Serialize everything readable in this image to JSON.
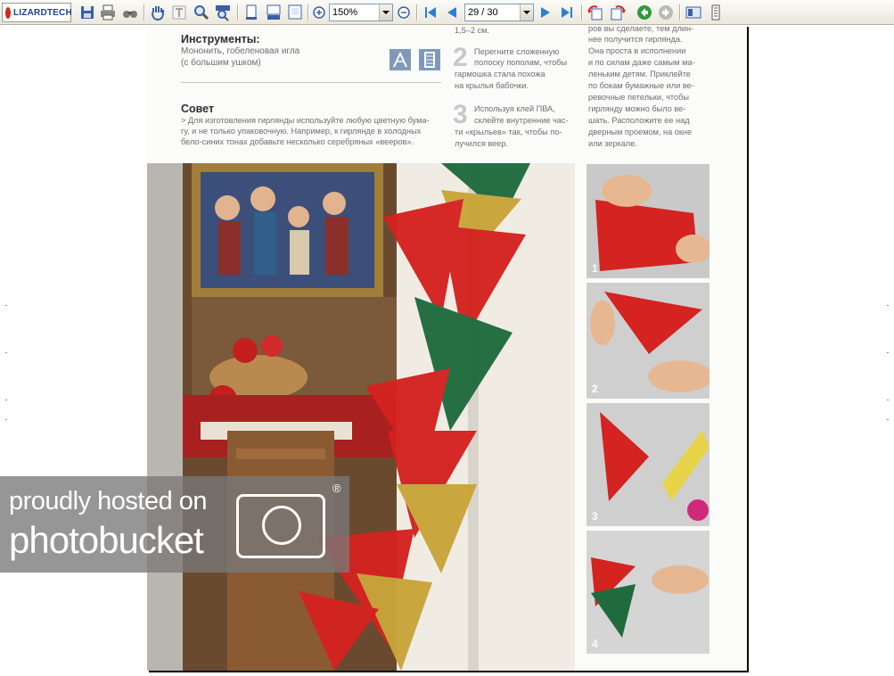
{
  "toolbar": {
    "brand": "LIZARDTECH",
    "zoom": "150%",
    "page_indicator": "29 / 30",
    "icons": [
      "save-icon",
      "print-icon",
      "find-icon",
      "hand-tool-icon",
      "text-select-icon",
      "zoom-tool-icon",
      "zoom-area-icon",
      "page-single-icon",
      "page-continuous-icon",
      "page-facing-icon",
      "zoom-in-icon",
      "zoom-out-icon",
      "first-page-icon",
      "previous-page-icon",
      "next-page-icon",
      "last-page-icon",
      "rotate-left-icon",
      "rotate-right-icon",
      "go-back-icon",
      "go-forward-icon",
      "thumbnails-icon",
      "info-icon"
    ]
  },
  "document": {
    "tools_heading": "Инструменты:",
    "tools_line1": "Мононить, гобеленовая игла",
    "tools_line2": "(с большим ушком)",
    "tip_heading": "Совет",
    "tip_line1": "> Для изготовления гирлянды используйте любую цветную бума-",
    "tip_line2": "гу, и не только упаковочную. Например, к гирлянде в холодных",
    "tip_line3": "бело-синих тонах добавьте несколько серебряных «вееров».",
    "col2_top": "1,5–2 см.",
    "step2_num": "2",
    "step2_line1": "Перегните сложенную",
    "step2_line2": "полоску пополам, чтобы",
    "step2_line3": "гармошка стала похожа",
    "step2_line4": "на крылья бабочки.",
    "step3_num": "3",
    "step3_line1": "Используя клей ПВА,",
    "step3_line2": "склейте внутренние час-",
    "step3_line3": "ти «крыльев» так, чтобы по-",
    "step3_line4": "лучился веер.",
    "col3_line1": "ров вы сделаете, тем длин-",
    "col3_line2": "нее получится гирлянда.",
    "col3_line3": "Она проста в исполнении",
    "col3_line4": "и по силам даже самым ма-",
    "col3_line5": "леньким детям. Приклейте",
    "col3_line6": "по бокам бумажные или ве-",
    "col3_line7": "ревочные петельки, чтобы",
    "col3_line8": "гирлянду можно было ве-",
    "col3_line9": "шать. Расположите ее над",
    "col3_line10": "дверным проемом, на окне",
    "col3_line11": "или зеркале.",
    "photo_labels": [
      "1",
      "2",
      "3",
      "4"
    ]
  },
  "watermark": {
    "line1": "proudly hosted on",
    "line2": "photobucket",
    "mark": "®"
  },
  "colors": {
    "toolbar_bg": "#ebe8dc",
    "garland_red": "#d42320",
    "garland_green": "#1f6b3e",
    "garland_gold": "#c9a43a",
    "watermark": "#787878"
  }
}
